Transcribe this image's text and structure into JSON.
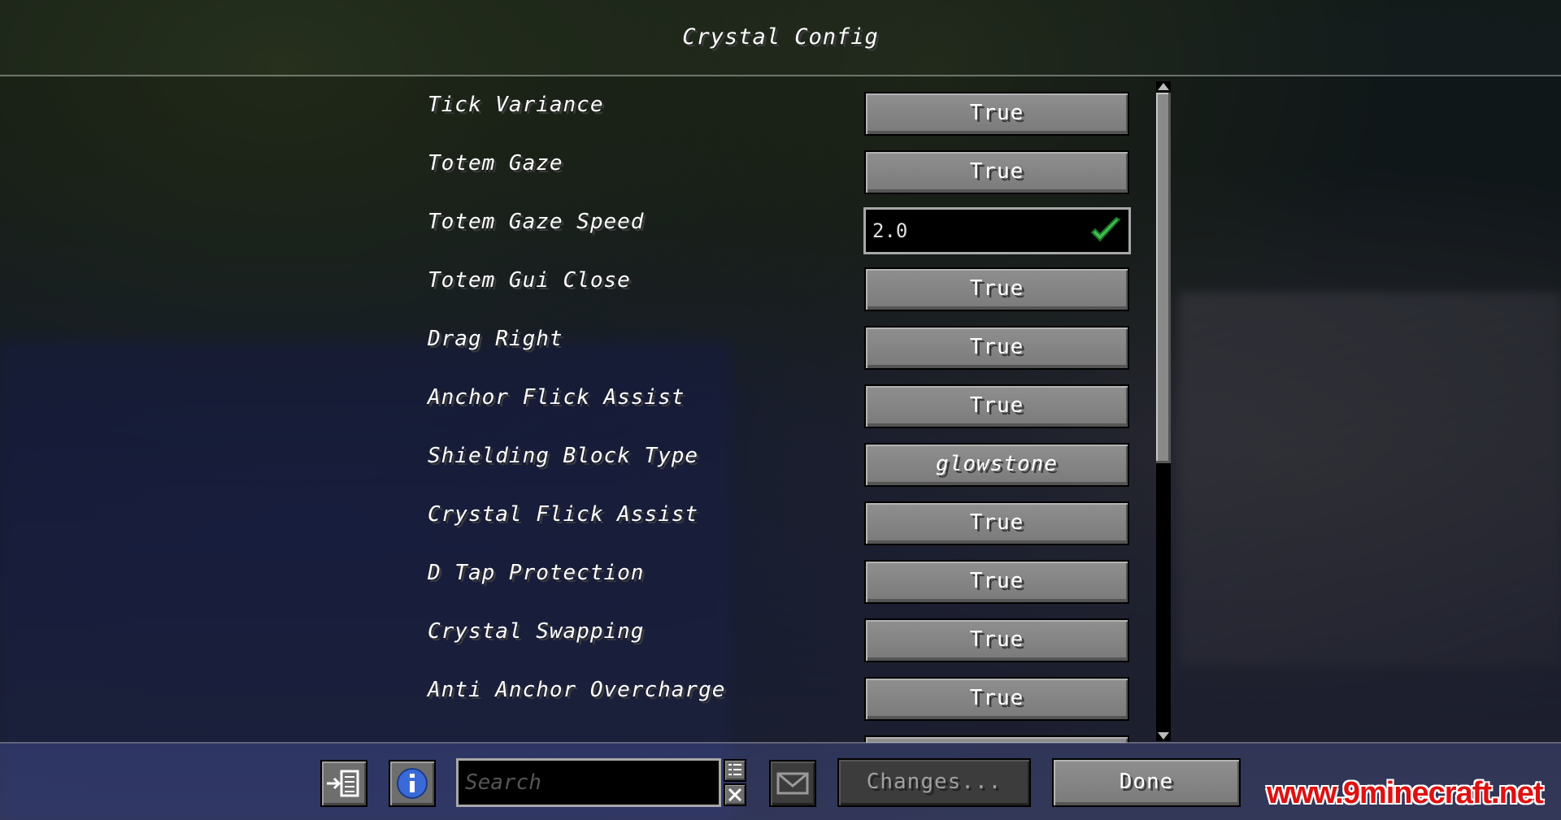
{
  "title": "Crystal Config",
  "entries": [
    {
      "label": "Tick Variance",
      "value": "True",
      "kind": "toggle"
    },
    {
      "label": "Totem Gaze",
      "value": "True",
      "kind": "toggle"
    },
    {
      "label": "Totem Gaze Speed",
      "value": "2.0",
      "kind": "number"
    },
    {
      "label": "Totem Gui Close",
      "value": "True",
      "kind": "toggle"
    },
    {
      "label": "Drag Right",
      "value": "True",
      "kind": "toggle"
    },
    {
      "label": "Anchor Flick Assist",
      "value": "True",
      "kind": "toggle"
    },
    {
      "label": "Shielding Block Type",
      "value": "glowstone",
      "kind": "enum"
    },
    {
      "label": "Crystal Flick Assist",
      "value": "True",
      "kind": "toggle"
    },
    {
      "label": "D Tap Protection",
      "value": "True",
      "kind": "toggle"
    },
    {
      "label": "Crystal Swapping",
      "value": "True",
      "kind": "toggle"
    },
    {
      "label": "Anti Anchor Overcharge",
      "value": "True",
      "kind": "toggle"
    }
  ],
  "scroll": {
    "position": 0.0,
    "visible_fraction": 0.57
  },
  "footer": {
    "search_placeholder": "Search",
    "changes_label": "Changes...",
    "done_label": "Done",
    "icons": [
      "exit-to-list-icon",
      "info-icon",
      "filter-list-icon",
      "clear-x-icon",
      "mail-icon"
    ]
  },
  "watermark": "www.9minecraft.net",
  "colors": {
    "valid_check": "#3fbf4f",
    "info": "#3a6ad8",
    "watermark": "#e01010"
  }
}
